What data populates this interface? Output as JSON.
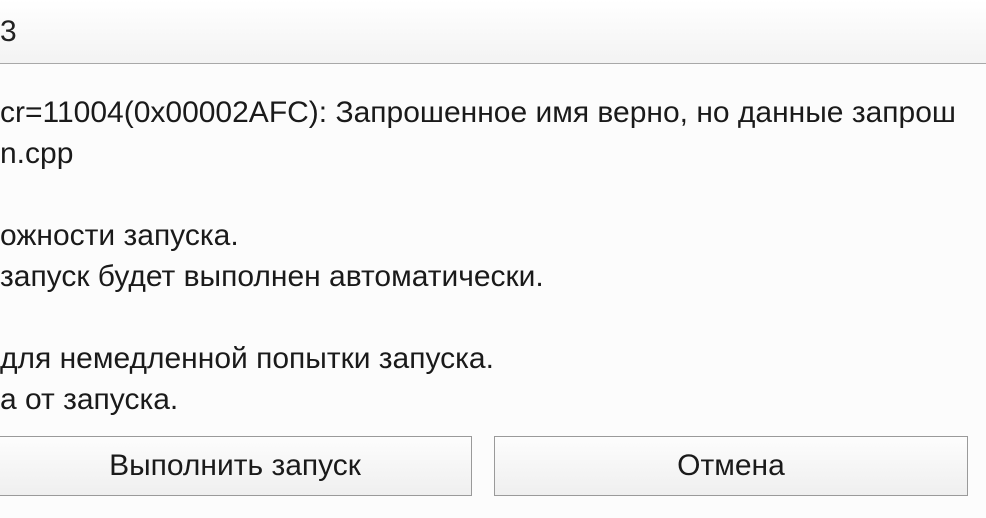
{
  "title": "3",
  "message": {
    "line1": "cr=11004(0x00002AFC): Запрошенное имя верно, но данные запрош",
    "line2": "n.cpp",
    "line3": "ожности запуска.",
    "line4": " запуск будет выполнен автоматически.",
    "line5": " для немедленной попытки запуска.",
    "line6": "а от запуска."
  },
  "buttons": {
    "execute": "Выполнить запуск",
    "cancel": "Отмена"
  }
}
